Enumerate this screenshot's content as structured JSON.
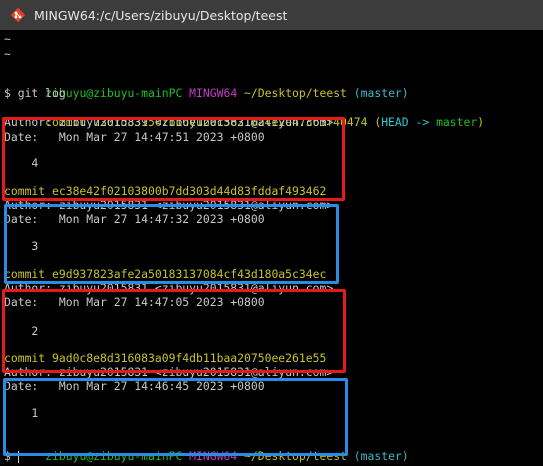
{
  "window": {
    "title": "MINGW64:/c/Users/zibuyu/Desktop/teest",
    "icon": "git-bash-icon"
  },
  "terminal": {
    "tilde1": "~",
    "tilde2": "~",
    "prompt1": {
      "user_host": "zibuyu@zibuyu-mainPC",
      "env": "MINGW64",
      "path": "~/Desktop/teest",
      "branch": "(master)"
    },
    "command": "$ git log",
    "commits": [
      {
        "hash_line": "commit 73dfd33950fb16e1bac3621624e2e47363f40474",
        "ref_open": "(",
        "ref_head": "HEAD -> ",
        "ref_branch": "master",
        "ref_close": ")",
        "author": "Author: zibuyu2015831 <zibuyu2015831@aliyun.com>",
        "date": "Date:   Mon Mar 27 14:47:51 2023 +0800",
        "message": "    4"
      },
      {
        "hash_line": "commit ec38e42f02103800b7dd303d44d83fddaf493462",
        "author": "Author: zibuyu2015831 <zibuyu2015831@aliyun.com>",
        "date": "Date:   Mon Mar 27 14:47:32 2023 +0800",
        "message": "    3"
      },
      {
        "hash_line": "commit e9d937823afe2a50183137084cf43d180a5c34ec",
        "author": "Author: zibuyu2015831 <zibuyu2015831@aliyun.com>",
        "date": "Date:   Mon Mar 27 14:47:05 2023 +0800",
        "message": "    2"
      },
      {
        "hash_line": "commit 9ad0c8e8d316083a09f4db11baa20750ee261e55",
        "author": "Author: zibuyu2015831 <zibuyu2015831@aliyun.com>",
        "date": "Date:   Mon Mar 27 14:46:45 2023 +0800",
        "message": "    1"
      }
    ],
    "prompt2": {
      "user_host": "zibuyu@zibuyu-mainPC",
      "env": "MINGW64",
      "path": "~/Desktop/teest",
      "branch": "(master)"
    },
    "final_prompt": "$ "
  },
  "annotation_colors": {
    "red": "#e8191b",
    "blue": "#2b8ce6"
  }
}
